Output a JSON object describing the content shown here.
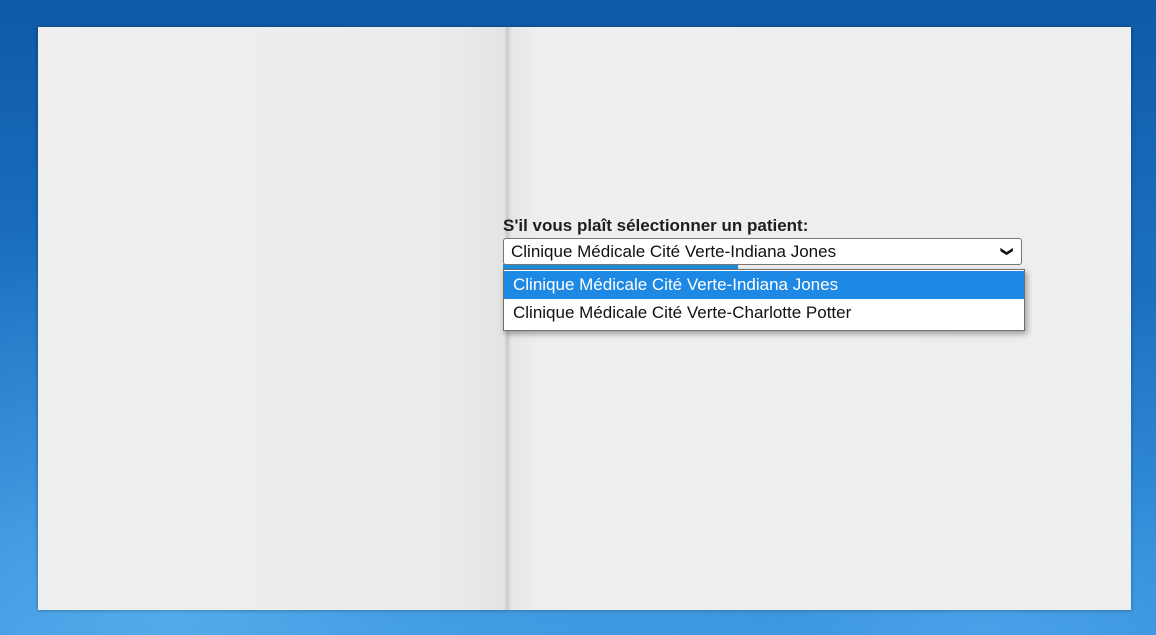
{
  "form": {
    "prompt": "S'il vous plaît sélectionner un patient:",
    "select": {
      "value": "Clinique Médicale Cité Verte-Indiana Jones",
      "options": [
        "Clinique Médicale Cité Verte-Indiana Jones",
        "Clinique Médicale Cité Verte-Charlotte Potter"
      ],
      "selected_index": 0
    },
    "submit_label": ""
  },
  "icons": {
    "dropdown": "chevron-down-icon"
  },
  "colors": {
    "desktop_background": "#1a6fbe",
    "panel_background": "#eeeeee",
    "accent": "#1e88e5",
    "button": "#1a84d6"
  }
}
